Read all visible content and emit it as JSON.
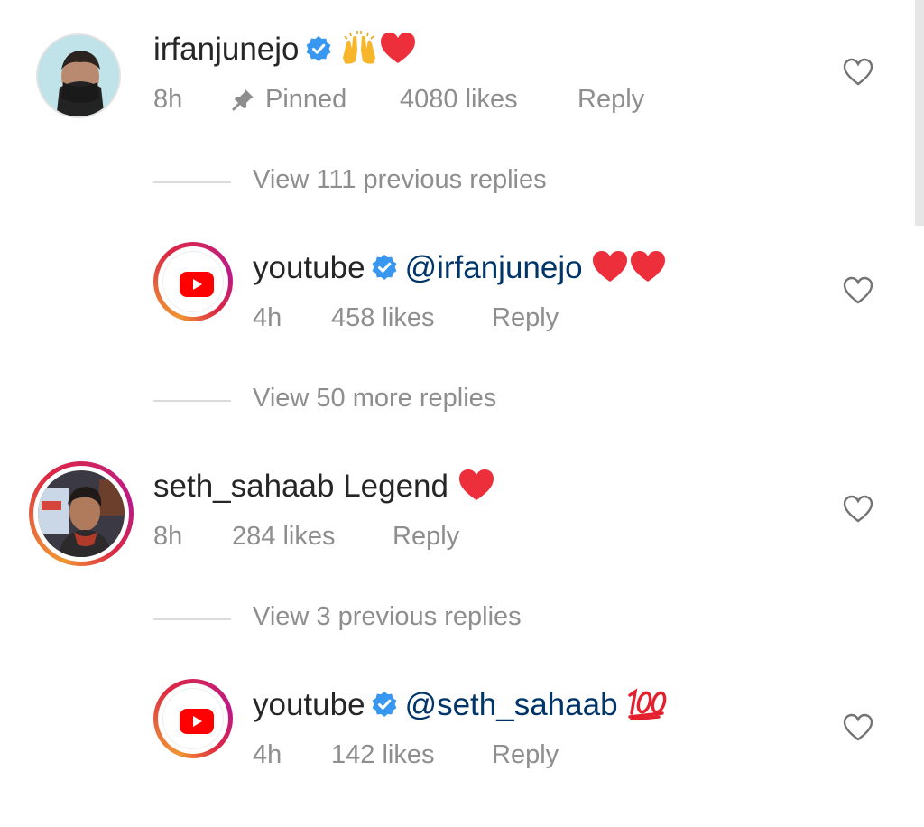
{
  "comments": [
    {
      "username": "irfanjunejo",
      "text": "",
      "time": "8h",
      "pinned_label": "Pinned",
      "likes": "4080 likes",
      "reply": "Reply",
      "emojis": [
        "raising-hands-emoji",
        "red-heart-emoji"
      ]
    },
    {
      "username": "youtube",
      "mention": "@irfanjunejo",
      "time": "4h",
      "likes": "458 likes",
      "reply": "Reply",
      "emojis": [
        "red-heart-emoji",
        "red-heart-emoji"
      ]
    },
    {
      "username": "seth_sahaab",
      "text": "Legend",
      "time": "8h",
      "likes": "284 likes",
      "reply": "Reply",
      "emojis": [
        "red-heart-emoji"
      ]
    },
    {
      "username": "youtube",
      "mention": "@seth_sahaab",
      "time": "4h",
      "likes": "142 likes",
      "reply": "Reply",
      "emojis": [
        "hundred-points-emoji"
      ]
    }
  ],
  "reply_toggles": [
    "View 111 previous replies",
    "View 50 more replies",
    "View 3 previous replies"
  ],
  "colors": {
    "verified": "#3897f0",
    "heart": "#ed2e3b",
    "mention": "#003569",
    "meta": "#8e8e8e",
    "youtube_red": "#ff0000"
  }
}
